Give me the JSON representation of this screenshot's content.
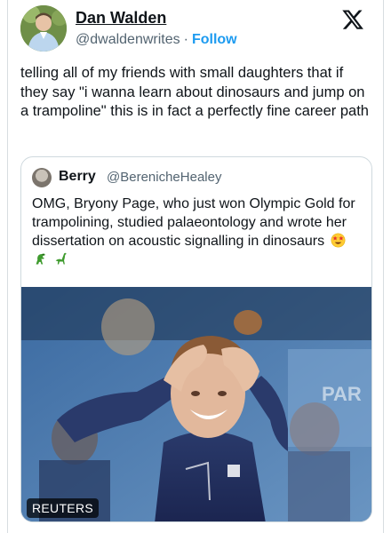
{
  "tweet": {
    "author": {
      "name": "Dan Walden",
      "handle": "@dwaldenwrites",
      "separator": "·",
      "follow_label": "Follow"
    },
    "text": "telling all of my friends with small daughters that if they say \"i wanna learn about dinosaurs and jump on a trampoline\" this is in fact a perfectly fine career path"
  },
  "quoted_tweet": {
    "author": {
      "name": "Berry",
      "handle": "@BerenicheHealey"
    },
    "text": "OMG, Bryony Page, who just won Olympic Gold for trampolining, studied palaeontology and wrote her dissertation on acoustic signalling in dinosaurs",
    "emojis": [
      "star-struck",
      "t-rex",
      "sauropod"
    ],
    "image": {
      "credit": "REUTERS",
      "backdrop_text": "PAR"
    }
  },
  "colors": {
    "link_blue": "#1d9bf0",
    "secondary_text": "#536471",
    "border": "#cfd9de"
  }
}
